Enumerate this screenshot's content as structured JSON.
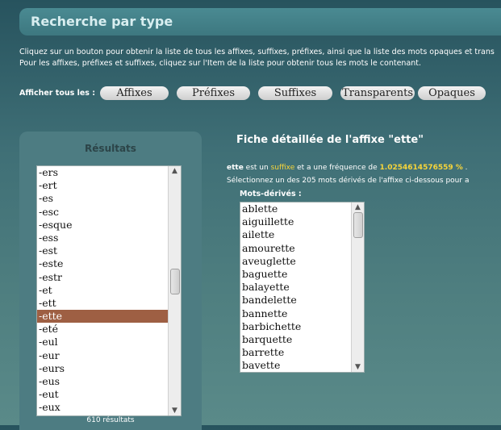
{
  "header": {
    "title": "Recherche par type"
  },
  "intro": {
    "line1": "Cliquez sur un bouton pour obtenir la liste de tous les affixes, suffixes, préfixes, ainsi que la liste des mots opaques et trans",
    "line2": "Pour les affixes, préfixes et suffixes, cliquez sur l'Item de la liste pour obtenir tous les mots le contenant."
  },
  "show_all": {
    "label": "Afficher tous les :",
    "buttons": [
      "Affixes",
      "Préfixes",
      "Suffixes",
      "Transparents",
      "Opaques"
    ]
  },
  "results": {
    "title": "Résultats",
    "items": [
      "-ers",
      "-ert",
      "-es",
      "-esc",
      "-esque",
      "-ess",
      "-est",
      "-este",
      "-estr",
      "-et",
      "-ett",
      "-ette",
      "-eté",
      "-eul",
      "-eur",
      "-eurs",
      "-eus",
      "-eut",
      "-eux"
    ],
    "selected_index": 11,
    "count_text": "610 résultats",
    "scroll_position": 0.45
  },
  "detail": {
    "title": "Fiche détaillée de l'affixe \"ette\"",
    "affix": "ette",
    "text_a": " est un ",
    "type": "suffixe",
    "text_b": " et a une fréquence de ",
    "frequency": "1.0254614576559 %",
    "text_c": " .",
    "instruction": "Sélectionnez un des 205 mots dérivés de l'affixe ci-dessous pour a",
    "derived_label": "Mots-dérivés :",
    "derived_words": [
      "ablette",
      "aiguillette",
      "ailette",
      "amourette",
      "aveuglette",
      "baguette",
      "balayette",
      "bandelette",
      "bannette",
      "barbichette",
      "barquette",
      "barrette",
      "bavette"
    ],
    "scroll_position": 0.0
  },
  "colors": {
    "selected_bg": "#9e5f43",
    "highlight": "#f6d43a"
  },
  "icons": {
    "scroll_up": "▲",
    "scroll_down": "▼"
  }
}
